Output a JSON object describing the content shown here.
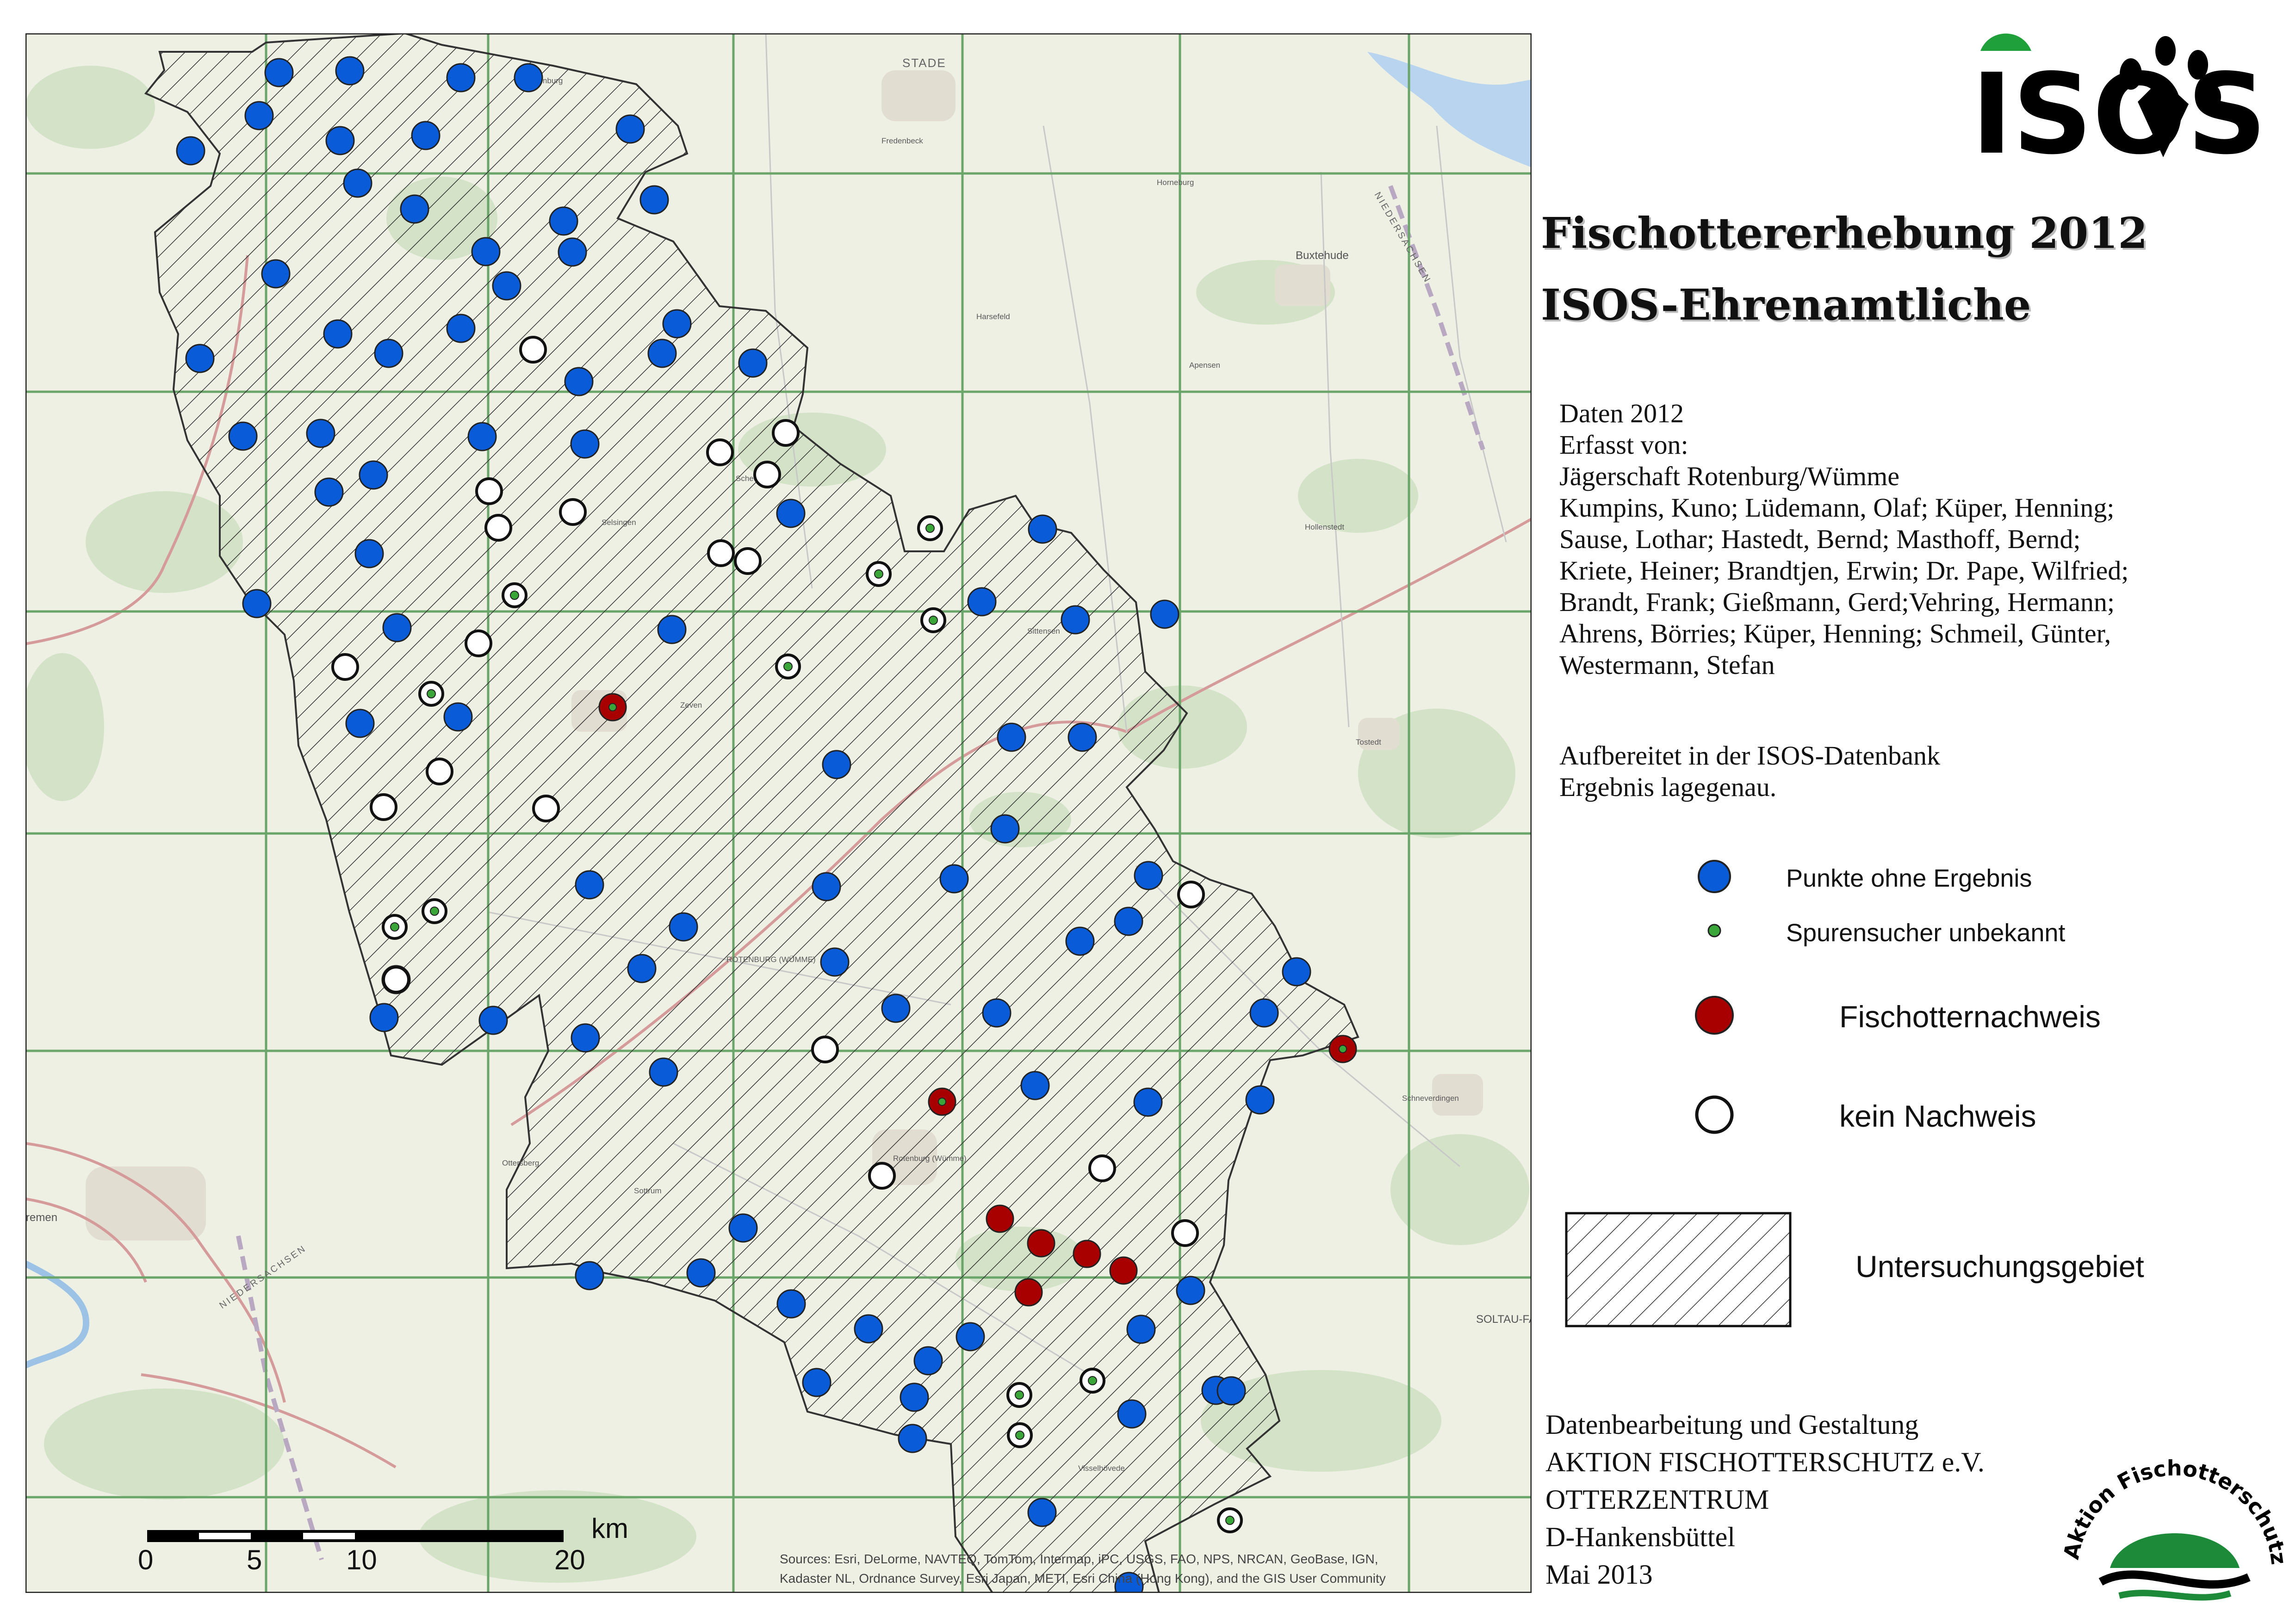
{
  "title_line1": "Fischottererhebung 2012",
  "title_line2": "ISOS-Ehrenamtliche",
  "logo_isos": "ISOS",
  "logo_aktion": "Aktion Fischotterschutz",
  "info_lines": [
    "Daten 2012",
    "Erfasst von:",
    "Jägerschaft Rotenburg/Wümme",
    "Kumpins, Kuno; Lüdemann, Olaf; Küper, Henning;",
    "Sause, Lothar; Hastedt, Bernd; Masthoff, Bernd;",
    "Kriete, Heiner; Brandtjen, Erwin; Dr. Pape, Wilfried;",
    "Brandt, Frank; Gießmann, Gerd;Vehring, Hermann;",
    "Ahrens, Börries; Küper, Henning; Schmeil, Günter,",
    "Westermann, Stefan"
  ],
  "processing_lines": [
    "Aufbereitet in der ISOS-Datenbank",
    "Ergebnis lagegenau."
  ],
  "legend": {
    "no_result": "Punkte ohne Ergebnis",
    "tracker_unknown": "Spurensucher unbekannt",
    "otter_found": "Fischotternachweis",
    "not_found": "kein Nachweis",
    "study_area": "Untersuchungsgebiet"
  },
  "credit_lines": [
    "Datenbearbeitung und Gestaltung",
    "AKTION FISCHOTTERSCHUTZ e.V.",
    "OTTERZENTRUM",
    "D-Hankensbüttel",
    "Mai 2013"
  ],
  "scale": {
    "unit": "km",
    "ticks": [
      "0",
      "5",
      "10",
      "20"
    ]
  },
  "attribution": [
    "Sources: Esri, DeLorme, NAVTEQ, TomTom, Intermap, iPC, USGS, FAO, NPS, NRCAN, GeoBase, IGN,",
    "Kadaster NL, Ordnance Survey, Esri Japan, METI, Esri China (Hong Kong), and the GIS User Community"
  ],
  "place_names": [
    {
      "name": "STADE",
      "cls": "city"
    },
    {
      "name": "Buxtehude",
      "cls": "big"
    },
    {
      "name": "NIEDERSACHSEN",
      "cls": "nds"
    },
    {
      "name": "Zeven",
      "cls": ""
    },
    {
      "name": "ROTENBURG (WÜMME)",
      "cls": ""
    },
    {
      "name": "Rotenburg (Wümme)",
      "cls": ""
    },
    {
      "name": "Schneverdingen",
      "cls": ""
    },
    {
      "name": "Harsefeld",
      "cls": ""
    },
    {
      "name": "Sittensen",
      "cls": ""
    },
    {
      "name": "Tostedt",
      "cls": ""
    },
    {
      "name": "Sottrum",
      "cls": ""
    },
    {
      "name": "Visselhövede",
      "cls": ""
    },
    {
      "name": "Horneburg",
      "cls": ""
    },
    {
      "name": "Apensen",
      "cls": ""
    },
    {
      "name": "Hollenstedt",
      "cls": ""
    },
    {
      "name": "Selsingen",
      "cls": ""
    },
    {
      "name": "Gnarrenburg",
      "cls": ""
    },
    {
      "name": "Scheeßel",
      "cls": ""
    },
    {
      "name": "Ottersberg",
      "cls": ""
    },
    {
      "name": "Fredenbeck",
      "cls": ""
    },
    {
      "name": "SOLTAU-FA",
      "cls": "big"
    },
    {
      "name": "NIEDERSACHSEN",
      "cls": "nds"
    },
    {
      "name": "Bremen",
      "cls": "big"
    }
  ],
  "colors": {
    "no_result": "#0a5bd8",
    "otter_found": "#a80000",
    "tracker_unknown": "#3aa63a",
    "grid": "#5fa05f",
    "map_bg": "#eef0e6"
  },
  "points_no_result": 104,
  "points_otter_found": 8,
  "points_not_found": 40
}
